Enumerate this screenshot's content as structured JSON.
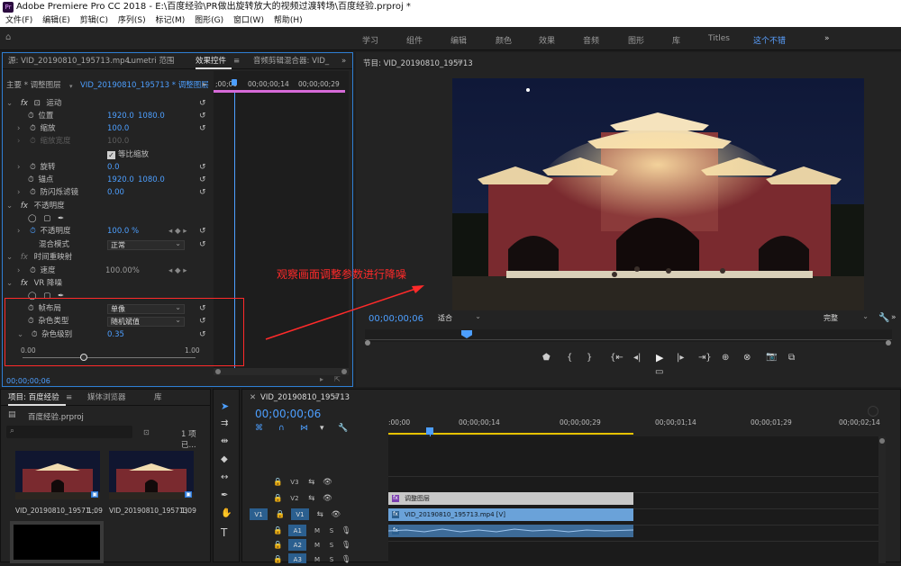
{
  "window": {
    "title": "Adobe Premiere Pro CC 2018 - E:\\百度经验\\PR做出旋转放大的视频过渡转场\\百度经验.prproj *",
    "icon": "Pr"
  },
  "menu": [
    "文件(F)",
    "编辑(E)",
    "剪辑(C)",
    "序列(S)",
    "标记(M)",
    "图形(G)",
    "窗口(W)",
    "帮助(H)"
  ],
  "workspaces": [
    "学习",
    "组件",
    "编辑",
    "颜色",
    "效果",
    "音频",
    "图形",
    "库",
    "Titles",
    "这个不错",
    "»"
  ],
  "active_workspace": "这个不错",
  "effects_panel": {
    "tabs": [
      "源: VID_20190810_195713.mp4",
      "Lumetri 范围",
      "效果控件",
      "音频剪辑混合器: VID_"
    ],
    "menu_glyph": "≡",
    "more_glyph": "»",
    "master": "主要 * 调整图层",
    "clip": "VID_20190810_195713 * 调整图层",
    "ruler": [
      ";00;00",
      "00;00;00;14",
      "00;00;00;29"
    ],
    "sections": {
      "motion": "运动",
      "opacity": "不透明度",
      "time_remap": "时间重映射",
      "vr_denoise": "VR 降噪"
    },
    "fx": "fx",
    "params": {
      "position": {
        "label": "位置",
        "x": "1920.0",
        "y": "1080.0"
      },
      "scale": {
        "label": "缩放",
        "value": "100.0"
      },
      "scale_width": {
        "label": "缩放宽度",
        "value": "100.0"
      },
      "uniform": "等比缩放",
      "rotation": {
        "label": "旋转",
        "value": "0.0"
      },
      "anchor": {
        "label": "锚点",
        "x": "1920.0",
        "y": "1080.0"
      },
      "antiflicker": {
        "label": "防闪烁滤镜",
        "value": "0.00"
      },
      "opacity": {
        "label": "不透明度",
        "value": "100.0 %"
      },
      "blend": {
        "label": "混合模式",
        "value": "正常"
      },
      "speed": {
        "label": "速度",
        "value": "100.00%"
      },
      "frame_layout": {
        "label": "帧布局",
        "value": "单像"
      },
      "noise_type": {
        "label": "杂色类型",
        "value": "随机斌值"
      },
      "noise_level": {
        "label": "杂色级别",
        "value": "0.35"
      },
      "slider_min": "0.00",
      "slider_max": "1.00"
    },
    "timecode": "00;00;00;06"
  },
  "program": {
    "title": "节目: VID_20190810_195713",
    "timecode": "00;00;00;06",
    "fit": "适合",
    "quality": "完整",
    "annotation": "观察画面调整参数进行降噪",
    "controls": [
      "marker-icon",
      "in-point-icon",
      "out-point-icon",
      "go-to-in-icon",
      "step-back-icon",
      "play-icon",
      "step-forward-icon",
      "go-to-out-icon",
      "insert-icon",
      "overwrite-icon",
      "export-frame-icon",
      "compare-icon",
      "safe-margins-icon"
    ]
  },
  "project": {
    "tabs": [
      "项目: 百度经验",
      "媒体浏览器",
      "库"
    ],
    "file": "百度经验.prproj",
    "count": "1 项已...",
    "items": [
      {
        "name": "VID_20190810_19571...",
        "duration": "1;09"
      },
      {
        "name": "VID_20190810_195713",
        "duration": "1;09"
      }
    ]
  },
  "timeline": {
    "title": "VID_20190810_195713",
    "timecode": "00;00;00;06",
    "ruler": [
      ":00;00",
      "00;00;00;14",
      "00;00;00;29",
      "00;00;01;14",
      "00;00;01;29",
      "00;00;02;14"
    ],
    "tracks": [
      {
        "name": "V3",
        "src": ""
      },
      {
        "name": "V2",
        "src": ""
      },
      {
        "name": "V1",
        "src": "V1"
      },
      {
        "name": "A1",
        "src": "A1"
      },
      {
        "name": "A2",
        "src": ""
      },
      {
        "name": "A3",
        "src": ""
      }
    ],
    "clips": {
      "adjustment": "调整图层",
      "video": "VID_20190810_195713.mp4 [V]"
    },
    "track_flags": {
      "mute": "M",
      "solo": "S"
    }
  },
  "colors": {
    "accent": "#4d9fff",
    "annotation": "#ff2a2a",
    "adjust_clip": "#c8c8c8",
    "video_clip": "#6aa2d9",
    "audio_clip": "#3d6b98"
  }
}
